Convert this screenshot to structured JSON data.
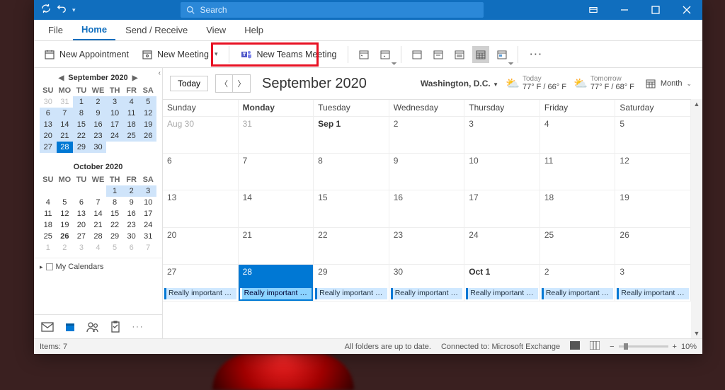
{
  "titlebar": {
    "search_placeholder": "Search"
  },
  "tabs": {
    "file": "File",
    "home": "Home",
    "send_receive": "Send / Receive",
    "view": "View",
    "help": "Help"
  },
  "ribbon": {
    "new_appointment": "New Appointment",
    "new_meeting": "New Meeting",
    "new_teams_meeting": "New Teams Meeting"
  },
  "leftpane": {
    "sept": {
      "title": "September 2020",
      "dow": [
        "SU",
        "MO",
        "TU",
        "WE",
        "TH",
        "FR",
        "SA"
      ],
      "cells": [
        {
          "n": "30",
          "dim": true
        },
        {
          "n": "31",
          "dim": true
        },
        {
          "n": "1",
          "range": true
        },
        {
          "n": "2",
          "range": true
        },
        {
          "n": "3",
          "range": true
        },
        {
          "n": "4",
          "range": true
        },
        {
          "n": "5",
          "range": true
        },
        {
          "n": "6",
          "range": true
        },
        {
          "n": "7",
          "range": true
        },
        {
          "n": "8",
          "range": true
        },
        {
          "n": "9",
          "range": true
        },
        {
          "n": "10",
          "range": true
        },
        {
          "n": "11",
          "range": true
        },
        {
          "n": "12",
          "range": true
        },
        {
          "n": "13",
          "range": true
        },
        {
          "n": "14",
          "range": true
        },
        {
          "n": "15",
          "range": true
        },
        {
          "n": "16",
          "range": true
        },
        {
          "n": "17",
          "range": true
        },
        {
          "n": "18",
          "range": true
        },
        {
          "n": "19",
          "range": true
        },
        {
          "n": "20",
          "range": true
        },
        {
          "n": "21",
          "range": true
        },
        {
          "n": "22",
          "range": true
        },
        {
          "n": "23",
          "range": true
        },
        {
          "n": "24",
          "range": true
        },
        {
          "n": "25",
          "range": true
        },
        {
          "n": "26",
          "range": true
        },
        {
          "n": "27",
          "range": true
        },
        {
          "n": "28",
          "today": true
        },
        {
          "n": "29",
          "range": true
        },
        {
          "n": "30",
          "range": true
        },
        {
          "n": "",
          "blank": true
        },
        {
          "n": "",
          "blank": true
        },
        {
          "n": "",
          "blank": true
        }
      ]
    },
    "oct": {
      "title": "October 2020",
      "dow": [
        "SU",
        "MO",
        "TU",
        "WE",
        "TH",
        "FR",
        "SA"
      ],
      "cells": [
        {
          "n": "",
          "blank": true
        },
        {
          "n": "",
          "blank": true
        },
        {
          "n": "",
          "blank": true
        },
        {
          "n": "",
          "blank": true
        },
        {
          "n": "1",
          "range": true
        },
        {
          "n": "2",
          "range": true
        },
        {
          "n": "3",
          "range": true
        },
        {
          "n": "4"
        },
        {
          "n": "5"
        },
        {
          "n": "6"
        },
        {
          "n": "7"
        },
        {
          "n": "8"
        },
        {
          "n": "9"
        },
        {
          "n": "10"
        },
        {
          "n": "11"
        },
        {
          "n": "12"
        },
        {
          "n": "13"
        },
        {
          "n": "14"
        },
        {
          "n": "15"
        },
        {
          "n": "16"
        },
        {
          "n": "17"
        },
        {
          "n": "18"
        },
        {
          "n": "19"
        },
        {
          "n": "20"
        },
        {
          "n": "21"
        },
        {
          "n": "22"
        },
        {
          "n": "23"
        },
        {
          "n": "24"
        },
        {
          "n": "25"
        },
        {
          "n": "26",
          "bold": true
        },
        {
          "n": "27"
        },
        {
          "n": "28"
        },
        {
          "n": "29"
        },
        {
          "n": "30"
        },
        {
          "n": "31"
        },
        {
          "n": "1",
          "dim": true
        },
        {
          "n": "2",
          "dim": true
        },
        {
          "n": "3",
          "dim": true
        },
        {
          "n": "4",
          "dim": true
        },
        {
          "n": "5",
          "dim": true
        },
        {
          "n": "6",
          "dim": true
        },
        {
          "n": "7",
          "dim": true
        }
      ]
    },
    "my_calendars": "My Calendars"
  },
  "calhead": {
    "today": "Today",
    "title": "September 2020",
    "location": "Washington, D.C.",
    "today_label": "Today",
    "today_temp": "77° F / 66° F",
    "tomorrow_label": "Tomorrow",
    "tomorrow_temp": "77° F / 68° F",
    "view_label": "Month"
  },
  "grid": {
    "headers": [
      "Sunday",
      "Monday",
      "Tuesday",
      "Wednesday",
      "Thursday",
      "Friday",
      "Saturday"
    ],
    "header_bold_index": 1,
    "weeks": [
      [
        {
          "t": "Aug 30",
          "dim": true
        },
        {
          "t": "31",
          "dim": true
        },
        {
          "t": "Sep 1",
          "bold": true
        },
        {
          "t": "2"
        },
        {
          "t": "3"
        },
        {
          "t": "4"
        },
        {
          "t": "5"
        }
      ],
      [
        {
          "t": "6"
        },
        {
          "t": "7"
        },
        {
          "t": "8"
        },
        {
          "t": "9"
        },
        {
          "t": "10"
        },
        {
          "t": "11"
        },
        {
          "t": "12"
        }
      ],
      [
        {
          "t": "13"
        },
        {
          "t": "14"
        },
        {
          "t": "15"
        },
        {
          "t": "16"
        },
        {
          "t": "17"
        },
        {
          "t": "18"
        },
        {
          "t": "19"
        }
      ],
      [
        {
          "t": "20"
        },
        {
          "t": "21"
        },
        {
          "t": "22"
        },
        {
          "t": "23"
        },
        {
          "t": "24"
        },
        {
          "t": "25"
        },
        {
          "t": "26"
        }
      ],
      [
        {
          "t": "27",
          "evt": "Really important m…"
        },
        {
          "t": "28",
          "today": true,
          "evt": "Really important m…"
        },
        {
          "t": "29",
          "evt": "Really important m…"
        },
        {
          "t": "30",
          "evt": "Really important m…"
        },
        {
          "t": "Oct 1",
          "bold": true,
          "evt": "Really important m…"
        },
        {
          "t": "2",
          "evt": "Really important m…"
        },
        {
          "t": "3",
          "evt": "Really important m…"
        }
      ]
    ]
  },
  "status": {
    "items": "Items: 7",
    "sync": "All folders are up to date.",
    "connected": "Connected to: Microsoft Exchange",
    "zoom": "10%"
  }
}
